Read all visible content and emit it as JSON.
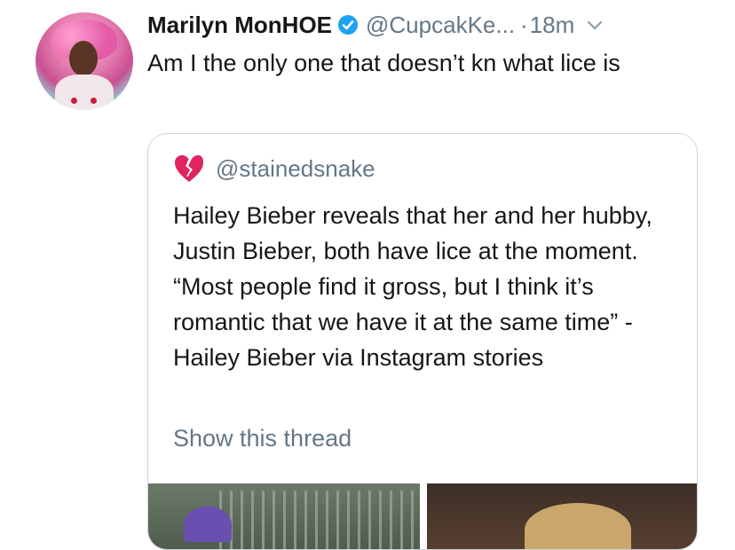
{
  "tweet": {
    "display_name": "Marilyn MonHOE",
    "handle": "@CupcakKe...",
    "separator": "·",
    "time": "18m",
    "text": "Am I the only one that doesn’t kn what lice is"
  },
  "quoted": {
    "handle": "@stainedsnake",
    "text": "Hailey Bieber reveals that her and her hubby, Justin Bieber, both have lice at the moment. “Most people find it gross, but I think it’s romantic that we have it at the same time” -Hailey Bieber via Instagram stories",
    "show_thread": "Show this thread"
  },
  "colors": {
    "verified": "#1da1f2",
    "secondary_text": "#657786",
    "border": "#ccd6dd",
    "broken_heart": "#e0245e"
  },
  "icons": [
    "verified-badge-icon",
    "chevron-down-icon",
    "broken-heart-icon"
  ]
}
